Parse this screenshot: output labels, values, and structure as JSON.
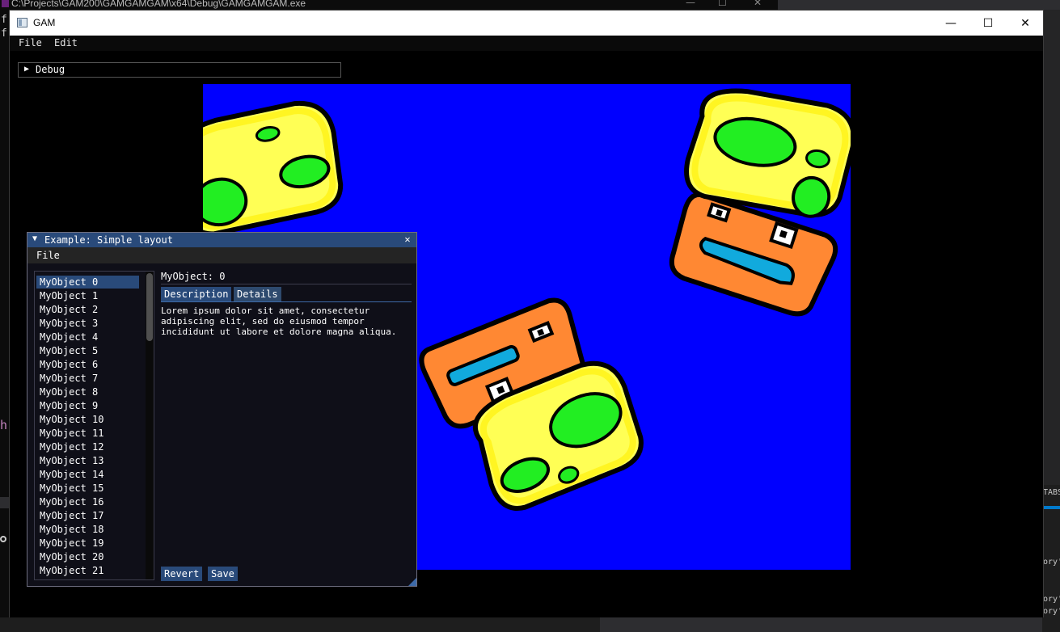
{
  "background": {
    "console_title": "C:\\Projects\\GAM200\\GAMGAMGAM\\x64\\Debug\\GAMGAMGAM.exe",
    "left_chars": [
      "f",
      "f",
      "h"
    ],
    "right_texts": [
      "TABS",
      "ory'",
      "ory'",
      "ory'"
    ]
  },
  "window": {
    "title": "GAM",
    "minimize_icon": "minimize-icon",
    "maximize_icon": "maximize-icon",
    "close_icon": "close-icon"
  },
  "menubar": {
    "items": [
      "File",
      "Edit"
    ]
  },
  "debug_window": {
    "label": "Debug",
    "collapsed": true
  },
  "viewport": {
    "background_color": "#0000ff"
  },
  "example_window": {
    "title": "Example: Simple layout",
    "menu": [
      "File"
    ],
    "list": [
      "MyObject 0",
      "MyObject 1",
      "MyObject 2",
      "MyObject 3",
      "MyObject 4",
      "MyObject 5",
      "MyObject 6",
      "MyObject 7",
      "MyObject 8",
      "MyObject 9",
      "MyObject 10",
      "MyObject 11",
      "MyObject 12",
      "MyObject 13",
      "MyObject 14",
      "MyObject 15",
      "MyObject 16",
      "MyObject 17",
      "MyObject 18",
      "MyObject 19",
      "MyObject 20",
      "MyObject 21"
    ],
    "selected_index": 0,
    "detail_title": "MyObject: 0",
    "tabs": [
      "Description",
      "Details"
    ],
    "active_tab": "Description",
    "description": "Lorem ipsum dolor sit amet, consectetur\nadipiscing elit, sed do eiusmod tempor\nincididunt ut labore et dolore magna aliqua.",
    "buttons": {
      "revert": "Revert",
      "save": "Save"
    }
  },
  "colors": {
    "imgui_title": "#294a7a",
    "imgui_bg": "#0f0f18",
    "yellow": "#ffff55",
    "orange": "#ff8833",
    "green": "#22ee22",
    "cyan": "#11aadd"
  }
}
